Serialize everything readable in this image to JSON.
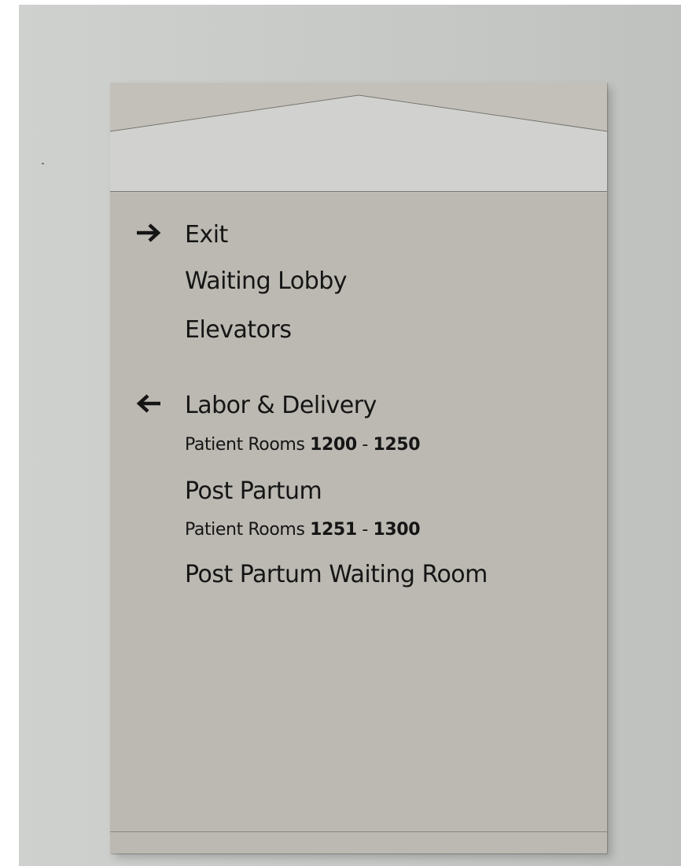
{
  "sign": {
    "group_right": {
      "arrow_icon": "arrow-right-icon",
      "items": [
        "Exit",
        "Waiting Lobby",
        "Elevators"
      ]
    },
    "group_left": {
      "arrow_icon": "arrow-left-icon",
      "destination_1": "Labor & Delivery",
      "destination_1_rooms": {
        "prefix": "Patient Rooms",
        "start": "1200",
        "dash": "-",
        "end": "1250"
      },
      "destination_2": "Post Partum",
      "destination_2_rooms": {
        "prefix": "Patient Rooms",
        "start": "1251",
        "dash": "-",
        "end": "1300"
      },
      "destination_3": "Post Partum Waiting Room"
    }
  },
  "colors": {
    "sign_face": "#bcb9b2",
    "sign_header": "#d1d2cf",
    "text": "#151515",
    "wall": "#c9cbc9"
  }
}
